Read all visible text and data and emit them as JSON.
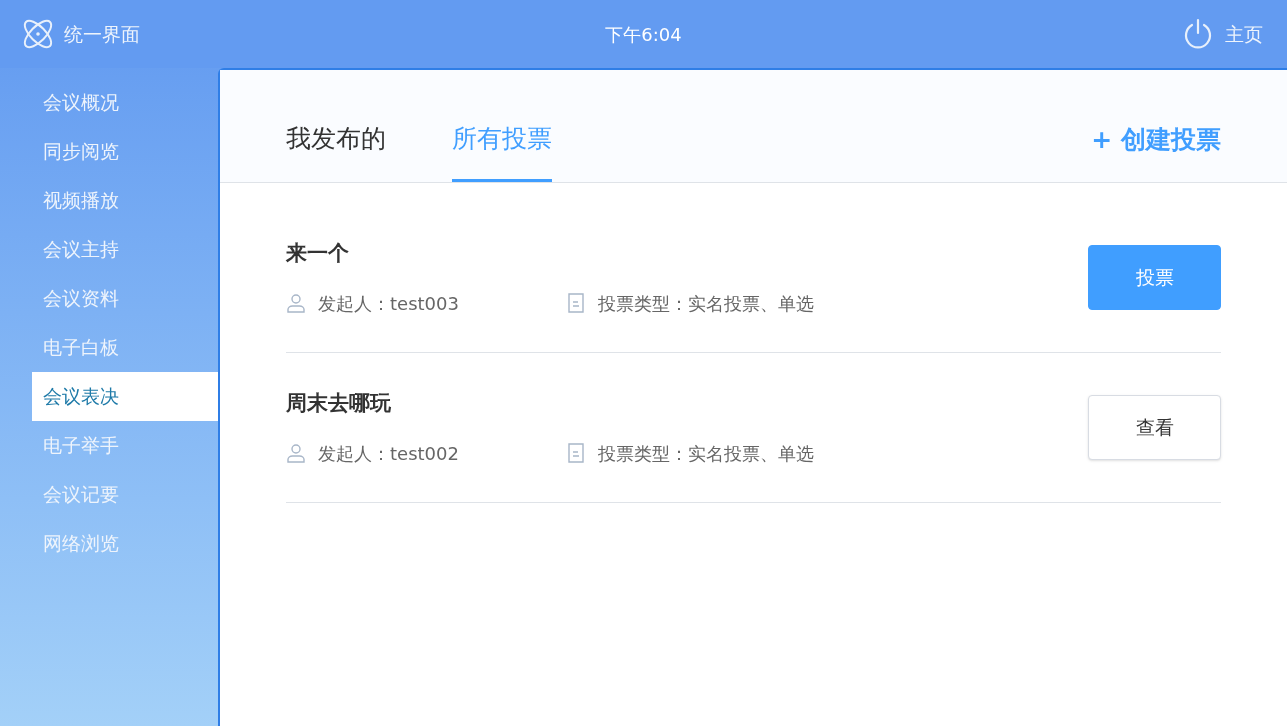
{
  "header": {
    "app_name": "统一界面",
    "time": "下午6:04",
    "home_label": "主页"
  },
  "sidebar": {
    "items": [
      {
        "label": "会议概况",
        "selected": false
      },
      {
        "label": "同步阅览",
        "selected": false
      },
      {
        "label": "视频播放",
        "selected": false
      },
      {
        "label": "会议主持",
        "selected": false
      },
      {
        "label": "会议资料",
        "selected": false
      },
      {
        "label": "电子白板",
        "selected": false
      },
      {
        "label": "会议表决",
        "selected": true
      },
      {
        "label": "电子举手",
        "selected": false
      },
      {
        "label": "会议记要",
        "selected": false
      },
      {
        "label": "网络浏览",
        "selected": false
      }
    ]
  },
  "tabs": [
    {
      "label": "我发布的",
      "selected": false
    },
    {
      "label": "所有投票",
      "selected": true
    }
  ],
  "create_button": "+ 创建投票",
  "polls": [
    {
      "title": "来一个",
      "initiator": "发起人：test003",
      "vote_type": "投票类型：实名投票、单选",
      "action": {
        "label": "投票",
        "kind": "primary"
      }
    },
    {
      "title": "周末去哪玩",
      "initiator": "发起人：test002",
      "vote_type": "投票类型：实名投票、单选",
      "action": {
        "label": "查看",
        "kind": "secondary"
      }
    }
  ]
}
